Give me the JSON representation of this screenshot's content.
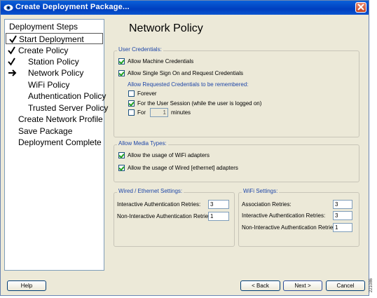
{
  "window": {
    "title": "Create Deployment Package...",
    "close_label": "×"
  },
  "steps": {
    "header": "Deployment Steps",
    "items": [
      {
        "label": "Start Deployment",
        "mark": "check"
      },
      {
        "label": "Create Policy",
        "mark": "check"
      },
      {
        "label": "Station Policy",
        "mark": "check"
      },
      {
        "label": "Network Policy",
        "mark": "arrow"
      },
      {
        "label": "WiFi Policy",
        "mark": ""
      },
      {
        "label": "Authentication Policy",
        "mark": ""
      },
      {
        "label": "Trusted Server Policy",
        "mark": ""
      },
      {
        "label": "Create Network Profile",
        "mark": ""
      },
      {
        "label": "Save Package",
        "mark": ""
      },
      {
        "label": "Deployment Complete",
        "mark": ""
      }
    ]
  },
  "page_title": "Network Policy",
  "user_credentials": {
    "legend": "User Credentials:",
    "allow_machine": {
      "label": "Allow Machine Credentials",
      "checked": true
    },
    "allow_sso": {
      "label": "Allow Single Sign On and Request Credentials",
      "checked": true
    },
    "remember_label": "Allow Requested Credentials to be remembered:",
    "forever": {
      "label": "Forever",
      "checked": false
    },
    "user_session": {
      "label": "For the User Session (while the user is logged on)",
      "checked": true
    },
    "for_minutes": {
      "label": "For",
      "checked": false,
      "value": "1",
      "suffix": "minutes"
    }
  },
  "media_types": {
    "legend": "Allow Media Types:",
    "wifi": {
      "label": "Allow the usage of WiFi adapters",
      "checked": true
    },
    "wired": {
      "label": "Allow the usage of Wired [ethernet] adapters",
      "checked": true
    }
  },
  "wired_settings": {
    "legend": "Wired / Ethernet Settings:",
    "interactive": {
      "label": "Interactive Authentication Retries:",
      "value": "3"
    },
    "non_interactive": {
      "label": "Non-Interactive Authentication Retries:",
      "value": "1"
    }
  },
  "wifi_settings": {
    "legend": "WiFi Settings:",
    "association": {
      "label": "Association Retries:",
      "value": "3"
    },
    "interactive": {
      "label": "Interactive Authentication Retries:",
      "value": "3"
    },
    "non_interactive": {
      "label": "Non-Interactive Authentication Retries:",
      "value": "1"
    }
  },
  "buttons": {
    "help": "Help",
    "back": "< Back",
    "next": "Next >",
    "cancel": "Cancel"
  },
  "figure_id": "221086"
}
